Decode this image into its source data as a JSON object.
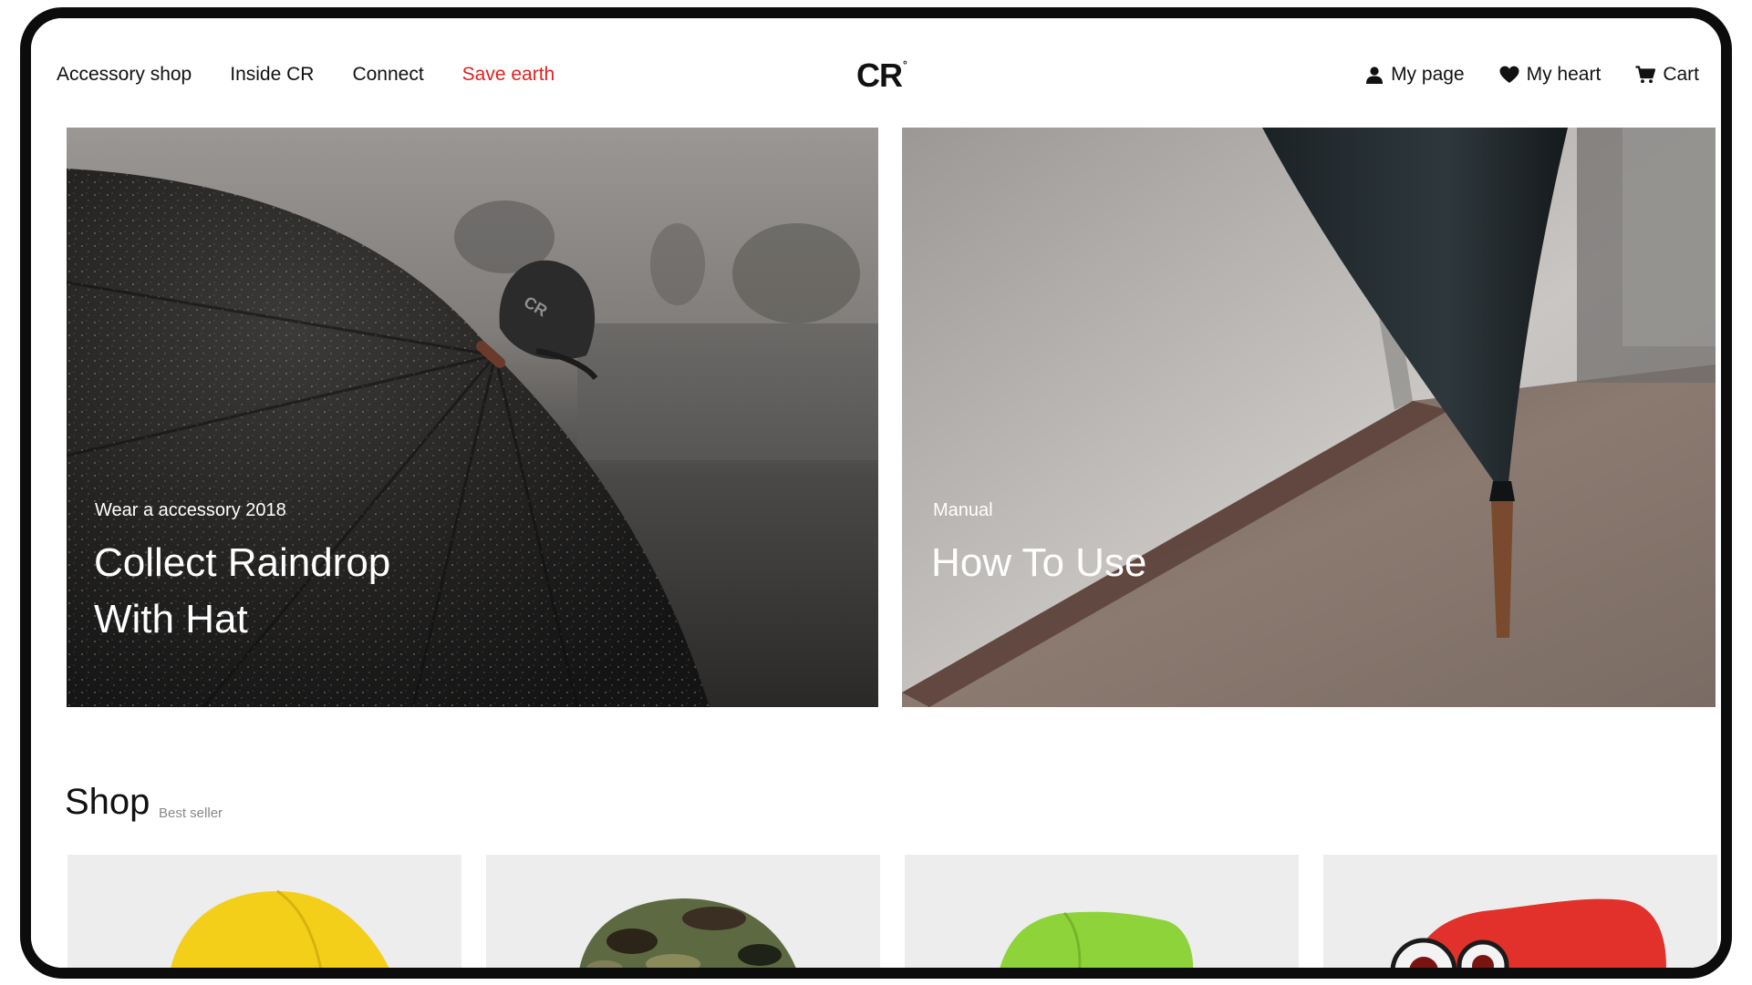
{
  "nav": {
    "left": [
      "Accessory shop",
      "Inside CR",
      "Connect",
      "Save earth"
    ],
    "logo": "CR",
    "logo_mark": "°",
    "right": {
      "my_page": "My page",
      "my_heart": "My heart",
      "cart": "Cart"
    }
  },
  "hero": [
    {
      "eyebrow": "Wear a accessory 2018",
      "title_line1": "Collect Raindrop",
      "title_line2": "With Hat",
      "image": "black umbrella with CR cap in the rain"
    },
    {
      "eyebrow": "Manual",
      "title_line1": "How To Use",
      "image": "closed umbrella leaning against a wall"
    }
  ],
  "shop": {
    "title": "Shop",
    "subtitle": "Best seller"
  },
  "products": [
    {
      "name": "yellow-cap",
      "color": "#f4cf1a"
    },
    {
      "name": "camo-cap",
      "color": "#4d5a35"
    },
    {
      "name": "green-cap",
      "color": "#8fd33a"
    },
    {
      "name": "red-cap-with-eyes",
      "color": "#e1312a"
    }
  ],
  "colors": {
    "accent": "#e0221f",
    "text": "#111111",
    "card_bg": "#ecedec"
  },
  "icons": [
    "user-icon",
    "heart-icon",
    "cart-icon"
  ]
}
